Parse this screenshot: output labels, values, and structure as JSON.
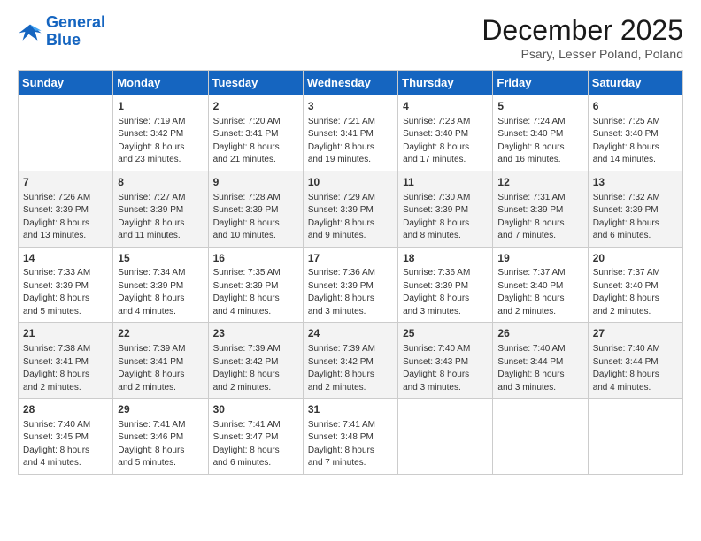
{
  "header": {
    "logo_line1": "General",
    "logo_line2": "Blue",
    "month_title": "December 2025",
    "location": "Psary, Lesser Poland, Poland"
  },
  "weekdays": [
    "Sunday",
    "Monday",
    "Tuesday",
    "Wednesday",
    "Thursday",
    "Friday",
    "Saturday"
  ],
  "weeks": [
    [
      {
        "num": "",
        "info": ""
      },
      {
        "num": "1",
        "info": "Sunrise: 7:19 AM\nSunset: 3:42 PM\nDaylight: 8 hours\nand 23 minutes."
      },
      {
        "num": "2",
        "info": "Sunrise: 7:20 AM\nSunset: 3:41 PM\nDaylight: 8 hours\nand 21 minutes."
      },
      {
        "num": "3",
        "info": "Sunrise: 7:21 AM\nSunset: 3:41 PM\nDaylight: 8 hours\nand 19 minutes."
      },
      {
        "num": "4",
        "info": "Sunrise: 7:23 AM\nSunset: 3:40 PM\nDaylight: 8 hours\nand 17 minutes."
      },
      {
        "num": "5",
        "info": "Sunrise: 7:24 AM\nSunset: 3:40 PM\nDaylight: 8 hours\nand 16 minutes."
      },
      {
        "num": "6",
        "info": "Sunrise: 7:25 AM\nSunset: 3:40 PM\nDaylight: 8 hours\nand 14 minutes."
      }
    ],
    [
      {
        "num": "7",
        "info": "Sunrise: 7:26 AM\nSunset: 3:39 PM\nDaylight: 8 hours\nand 13 minutes."
      },
      {
        "num": "8",
        "info": "Sunrise: 7:27 AM\nSunset: 3:39 PM\nDaylight: 8 hours\nand 11 minutes."
      },
      {
        "num": "9",
        "info": "Sunrise: 7:28 AM\nSunset: 3:39 PM\nDaylight: 8 hours\nand 10 minutes."
      },
      {
        "num": "10",
        "info": "Sunrise: 7:29 AM\nSunset: 3:39 PM\nDaylight: 8 hours\nand 9 minutes."
      },
      {
        "num": "11",
        "info": "Sunrise: 7:30 AM\nSunset: 3:39 PM\nDaylight: 8 hours\nand 8 minutes."
      },
      {
        "num": "12",
        "info": "Sunrise: 7:31 AM\nSunset: 3:39 PM\nDaylight: 8 hours\nand 7 minutes."
      },
      {
        "num": "13",
        "info": "Sunrise: 7:32 AM\nSunset: 3:39 PM\nDaylight: 8 hours\nand 6 minutes."
      }
    ],
    [
      {
        "num": "14",
        "info": "Sunrise: 7:33 AM\nSunset: 3:39 PM\nDaylight: 8 hours\nand 5 minutes."
      },
      {
        "num": "15",
        "info": "Sunrise: 7:34 AM\nSunset: 3:39 PM\nDaylight: 8 hours\nand 4 minutes."
      },
      {
        "num": "16",
        "info": "Sunrise: 7:35 AM\nSunset: 3:39 PM\nDaylight: 8 hours\nand 4 minutes."
      },
      {
        "num": "17",
        "info": "Sunrise: 7:36 AM\nSunset: 3:39 PM\nDaylight: 8 hours\nand 3 minutes."
      },
      {
        "num": "18",
        "info": "Sunrise: 7:36 AM\nSunset: 3:39 PM\nDaylight: 8 hours\nand 3 minutes."
      },
      {
        "num": "19",
        "info": "Sunrise: 7:37 AM\nSunset: 3:40 PM\nDaylight: 8 hours\nand 2 minutes."
      },
      {
        "num": "20",
        "info": "Sunrise: 7:37 AM\nSunset: 3:40 PM\nDaylight: 8 hours\nand 2 minutes."
      }
    ],
    [
      {
        "num": "21",
        "info": "Sunrise: 7:38 AM\nSunset: 3:41 PM\nDaylight: 8 hours\nand 2 minutes."
      },
      {
        "num": "22",
        "info": "Sunrise: 7:39 AM\nSunset: 3:41 PM\nDaylight: 8 hours\nand 2 minutes."
      },
      {
        "num": "23",
        "info": "Sunrise: 7:39 AM\nSunset: 3:42 PM\nDaylight: 8 hours\nand 2 minutes."
      },
      {
        "num": "24",
        "info": "Sunrise: 7:39 AM\nSunset: 3:42 PM\nDaylight: 8 hours\nand 2 minutes."
      },
      {
        "num": "25",
        "info": "Sunrise: 7:40 AM\nSunset: 3:43 PM\nDaylight: 8 hours\nand 3 minutes."
      },
      {
        "num": "26",
        "info": "Sunrise: 7:40 AM\nSunset: 3:44 PM\nDaylight: 8 hours\nand 3 minutes."
      },
      {
        "num": "27",
        "info": "Sunrise: 7:40 AM\nSunset: 3:44 PM\nDaylight: 8 hours\nand 4 minutes."
      }
    ],
    [
      {
        "num": "28",
        "info": "Sunrise: 7:40 AM\nSunset: 3:45 PM\nDaylight: 8 hours\nand 4 minutes."
      },
      {
        "num": "29",
        "info": "Sunrise: 7:41 AM\nSunset: 3:46 PM\nDaylight: 8 hours\nand 5 minutes."
      },
      {
        "num": "30",
        "info": "Sunrise: 7:41 AM\nSunset: 3:47 PM\nDaylight: 8 hours\nand 6 minutes."
      },
      {
        "num": "31",
        "info": "Sunrise: 7:41 AM\nSunset: 3:48 PM\nDaylight: 8 hours\nand 7 minutes."
      },
      {
        "num": "",
        "info": ""
      },
      {
        "num": "",
        "info": ""
      },
      {
        "num": "",
        "info": ""
      }
    ]
  ]
}
